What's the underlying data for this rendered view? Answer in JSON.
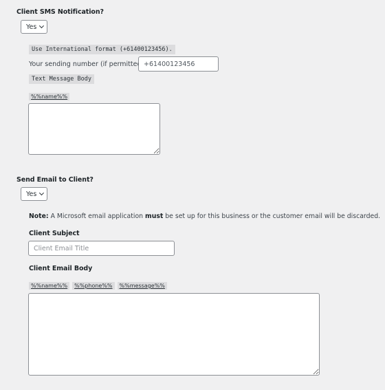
{
  "sms": {
    "title": "Client SMS Notification?",
    "select_value": "Yes",
    "format_hint": "Use International format (+61400123456).",
    "sending_label": "Your sending number (if permitted):",
    "sending_placeholder": "+61400123456",
    "body_label": "Text Message Body",
    "tags": [
      "%%name%%"
    ],
    "body_value": ""
  },
  "email": {
    "title": "Send Email to Client?",
    "select_value": "Yes",
    "note_label": "Note:",
    "note_pre": " A Microsoft email application ",
    "note_bold": "must",
    "note_post": " be set up for this business or the customer email will be discarded.",
    "subject_label": "Client Subject",
    "subject_placeholder": "Client Email Title",
    "body_label": "Client Email Body",
    "tags": [
      "%%name%%",
      "%%phone%%",
      "%%message%%"
    ],
    "body_value": ""
  }
}
